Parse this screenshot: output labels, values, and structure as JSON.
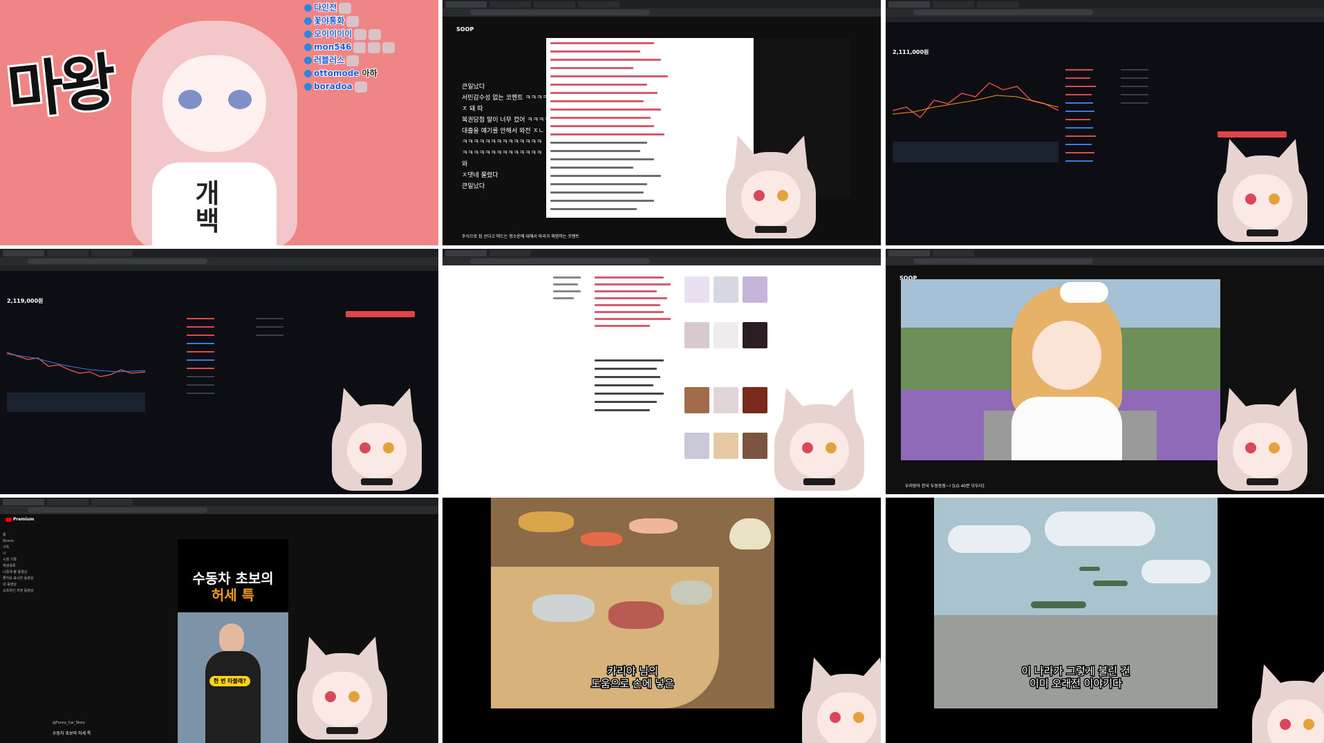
{
  "tile1": {
    "overlay": "마왕",
    "shirt_text": "개 백",
    "chat": [
      {
        "nick": "다인전",
        "text": ""
      },
      {
        "nick": "꽃야통화",
        "text": ""
      },
      {
        "nick": "오이이이이",
        "text": ""
      },
      {
        "nick": "mon546",
        "text": ""
      },
      {
        "nick": "러블러스",
        "text": ""
      },
      {
        "nick": "ottomode",
        "text": "아하"
      },
      {
        "nick": "boradoa",
        "text": ""
      }
    ]
  },
  "tile2": {
    "logo": "SOOP",
    "overlay_lines": [
      "큰일났다",
      "서민감수성 없는 코멘트 ㅋㅋㅋㅋ",
      "ㅈ 돼 따",
      "복권당첨 말이 너무 컸어 ㅋㅋㅋㅋ",
      "대출을 얘기를 안해서 와전 ㅈㄴ",
      "ㅋㅋㅋㅋㅋㅋㅋㅋㅋㅋㅋㅋㅋㅋ",
      "ㅋㅋㅋㅋㅋㅋㅋㅋㅋㅋㅋㅋㅋㅋ",
      "와",
      "ㅈ댓네 물렸다",
      "큰일났다"
    ],
    "caption": "주식으로 집 산다고 떠드는 청소윤에 대해서 마리가 해명하는 코멘트"
  },
  "trade": {
    "price_a": "2,111,000원",
    "price_b": "2,119,000원"
  },
  "tile6": {
    "logo": "SOOP",
    "title": "우리랑아 한국 두둥등장~! [LG 40분 모두다]"
  },
  "tile7": {
    "brand": "Premium",
    "short_title_line1": "수동차 초보의",
    "short_title_line2": "허세 특",
    "pill": "한 번 타볼래?",
    "handle": "@Funny_Car_Story",
    "video_title": "수동차 초보의 허세 특",
    "sidebar": [
      "홈",
      "Shorts",
      "구독",
      "나",
      "시청 기록",
      "재생목록",
      "나중에 볼 동영상",
      "좋아요 표시한 동영상",
      "내 동영상",
      "오프라인 저장 동영상"
    ]
  },
  "tile8": {
    "subtitle_line1": "카리야 님의",
    "subtitle_line2": "도움으로 손에 넣은"
  },
  "tile9": {
    "subtitle_line1": "이 나라가 그렇게 불린 건",
    "subtitle_line2": "이미 오래전 이야기다"
  },
  "colors": {
    "tile1_bg": "#f08585",
    "trade_red": "#e04a4a",
    "trade_blue": "#3d7be6",
    "chat_green": "#4cd137",
    "yt_red": "#ff0000"
  }
}
